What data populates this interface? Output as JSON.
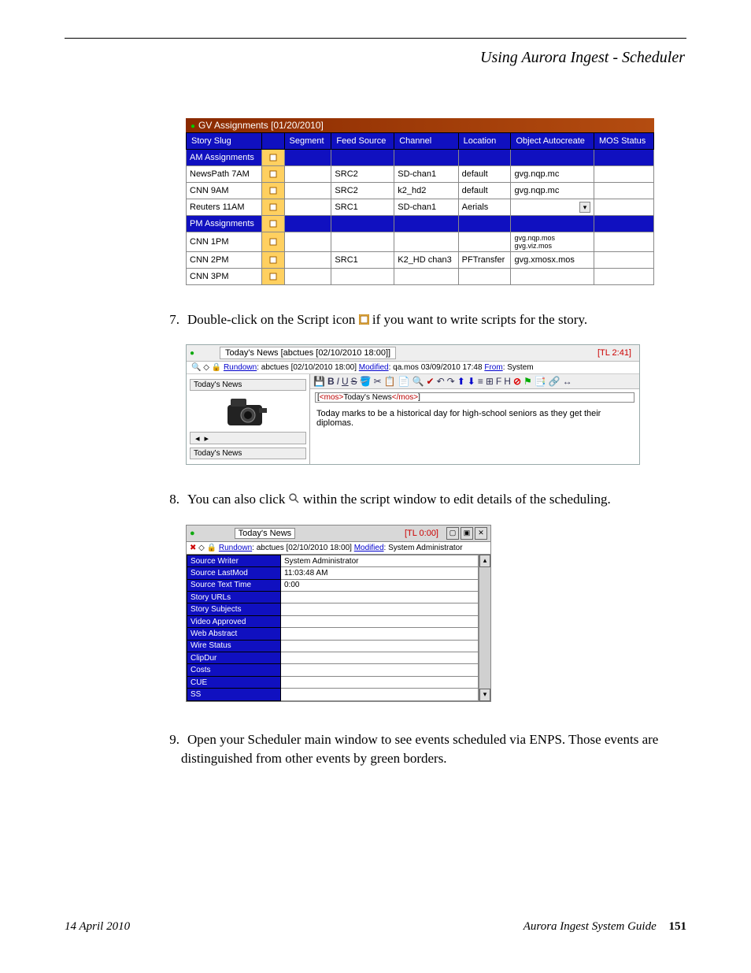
{
  "header": {
    "section_title": "Using Aurora Ingest - Scheduler"
  },
  "steps": {
    "s7": {
      "num": "7.",
      "text_a": "Double-click on the Script icon ",
      "text_b": " if you want to write scripts for the story."
    },
    "s8": {
      "num": "8.",
      "text_a": "You can also click ",
      "text_b": " within the script window to edit details of the scheduling."
    },
    "s9": {
      "num": "9.",
      "text": "Open your Scheduler main window to see events scheduled via ENPS. Those events are distinguished from other events by green borders."
    }
  },
  "fig1": {
    "title": "GV Assignments [01/20/2010]",
    "headers": [
      "Story Slug",
      "",
      "Segment",
      "Feed Source",
      "Channel",
      "Location",
      "Object Autocreate",
      "MOS Status"
    ],
    "rows": [
      {
        "type": "group",
        "slug": "AM Assignments"
      },
      {
        "slug": "NewsPath 7AM",
        "segment": "",
        "feed": "SRC2",
        "channel": "SD-chan1",
        "location": "default",
        "obj": "gvg.nqp.mc",
        "mos": ""
      },
      {
        "slug": "CNN 9AM",
        "segment": "",
        "feed": "SRC2",
        "channel": "k2_hd2",
        "location": "default",
        "obj": "gvg.nqp.mc",
        "mos": ""
      },
      {
        "slug": "Reuters 11AM",
        "segment": "",
        "feed": "SRC1",
        "channel": "SD-chan1",
        "location": "Aerials",
        "obj": "dropdown",
        "mos": ""
      },
      {
        "type": "group",
        "slug": "PM Assignments"
      },
      {
        "slug": "CNN 1PM",
        "segment": "",
        "feed": "",
        "channel": "",
        "location": "",
        "obj": "gvg.nqp.mos\ngvg.viz.mos",
        "mos": ""
      },
      {
        "slug": "CNN 2PM",
        "segment": "",
        "feed": "SRC1",
        "channel": "K2_HD chan3",
        "location": "PFTransfer",
        "obj": "gvg.xmosx.mos",
        "mos": ""
      },
      {
        "slug": "CNN 3PM",
        "segment": "",
        "feed": "",
        "channel": "",
        "location": "",
        "obj": "",
        "mos": ""
      }
    ]
  },
  "fig2": {
    "tab_title": "Today's News [abctues [02/10/2010 18:00]]",
    "tl": "[TL 2:41]",
    "sub_rundown_label": "Rundown",
    "sub_rundown": ": abctues [02/10/2010 18:00]  ",
    "sub_modified_label": "Modified",
    "sub_modified": ": qa.mos  03/09/2010 17:48 ",
    "sub_from_label": "From",
    "sub_from": ": System",
    "left_caption": "Today's News",
    "mos_tag_open": "<mos>",
    "mos_tag_close": "</mos>",
    "mos_text": "Today's News",
    "body_text": "Today marks to be a historical day for high-school seniors as they get their diplomas.",
    "bottom_caption": "Today's News"
  },
  "fig3": {
    "tab_title": "Today's News",
    "tl": "[TL 0:00]",
    "sub_rundown_label": "Rundown",
    "sub_rundown": ": abctues [02/10/2010 18:00]  ",
    "sub_modified_label": "Modified",
    "sub_modified": ": System Administrator",
    "fields": [
      {
        "label": "Source Writer",
        "value": "System Administrator"
      },
      {
        "label": "Source LastMod",
        "value": "11:03:48 AM"
      },
      {
        "label": "Source Text Time",
        "value": "0:00"
      },
      {
        "label": "Story URLs",
        "value": ""
      },
      {
        "label": "Story Subjects",
        "value": ""
      },
      {
        "label": "Video Approved",
        "value": ""
      },
      {
        "label": "Web Abstract",
        "value": ""
      },
      {
        "label": "Wire Status",
        "value": ""
      },
      {
        "label": "ClipDur",
        "value": ""
      },
      {
        "label": "Costs",
        "value": ""
      },
      {
        "label": "CUE",
        "value": ""
      },
      {
        "label": "SS",
        "value": ""
      }
    ]
  },
  "footer": {
    "date": "14 April 2010",
    "guide": "Aurora Ingest System Guide",
    "page": "151"
  }
}
